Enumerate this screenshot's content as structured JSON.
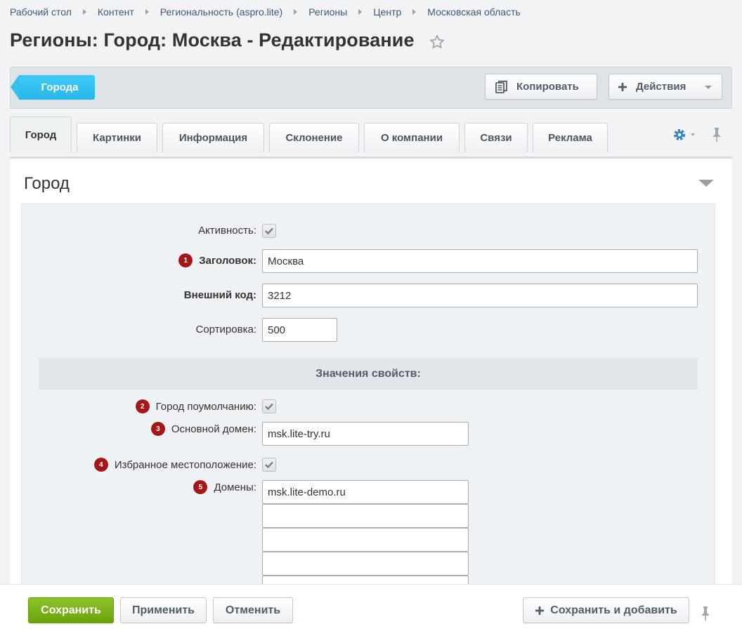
{
  "breadcrumb": [
    "Рабочий стол",
    "Контент",
    "Региональность (aspro.lite)",
    "Регионы",
    "Центр",
    "Московская область"
  ],
  "page": {
    "title": "Регионы: Город: Москва - Редактирование"
  },
  "toolbar": {
    "back_label": "Города",
    "copy_label": "Копировать",
    "actions_label": "Действия"
  },
  "tabs": [
    "Город",
    "Картинки",
    "Информация",
    "Склонение",
    "О компании",
    "Связи",
    "Реклама"
  ],
  "section": {
    "title": "Город"
  },
  "form": {
    "active_label": "Активность:",
    "title_label": "Заголовок:",
    "title_value": "Москва",
    "external_code_label": "Внешний код:",
    "external_code_value": "3212",
    "sort_label": "Сортировка:",
    "sort_value": "500",
    "props_header": "Значения свойств:",
    "default_city_label": "Город поумолчанию:",
    "main_domain_label": "Основной домен:",
    "main_domain_value": "msk.lite-try.ru",
    "favorite_label": "Избранное местоположение:",
    "domains_label": "Домены:",
    "domains_values": [
      "msk.lite-demo.ru",
      "",
      "",
      "",
      ""
    ],
    "markers": [
      "1",
      "2",
      "3",
      "4",
      "5"
    ]
  },
  "footer": {
    "save_label": "Сохранить",
    "apply_label": "Применить",
    "cancel_label": "Отменить",
    "save_add_label": "Сохранить и добавить"
  },
  "colors": {
    "accent_blue": "#3bc8f5",
    "save_green": "#7ab31b",
    "marker_red": "#a51616"
  }
}
